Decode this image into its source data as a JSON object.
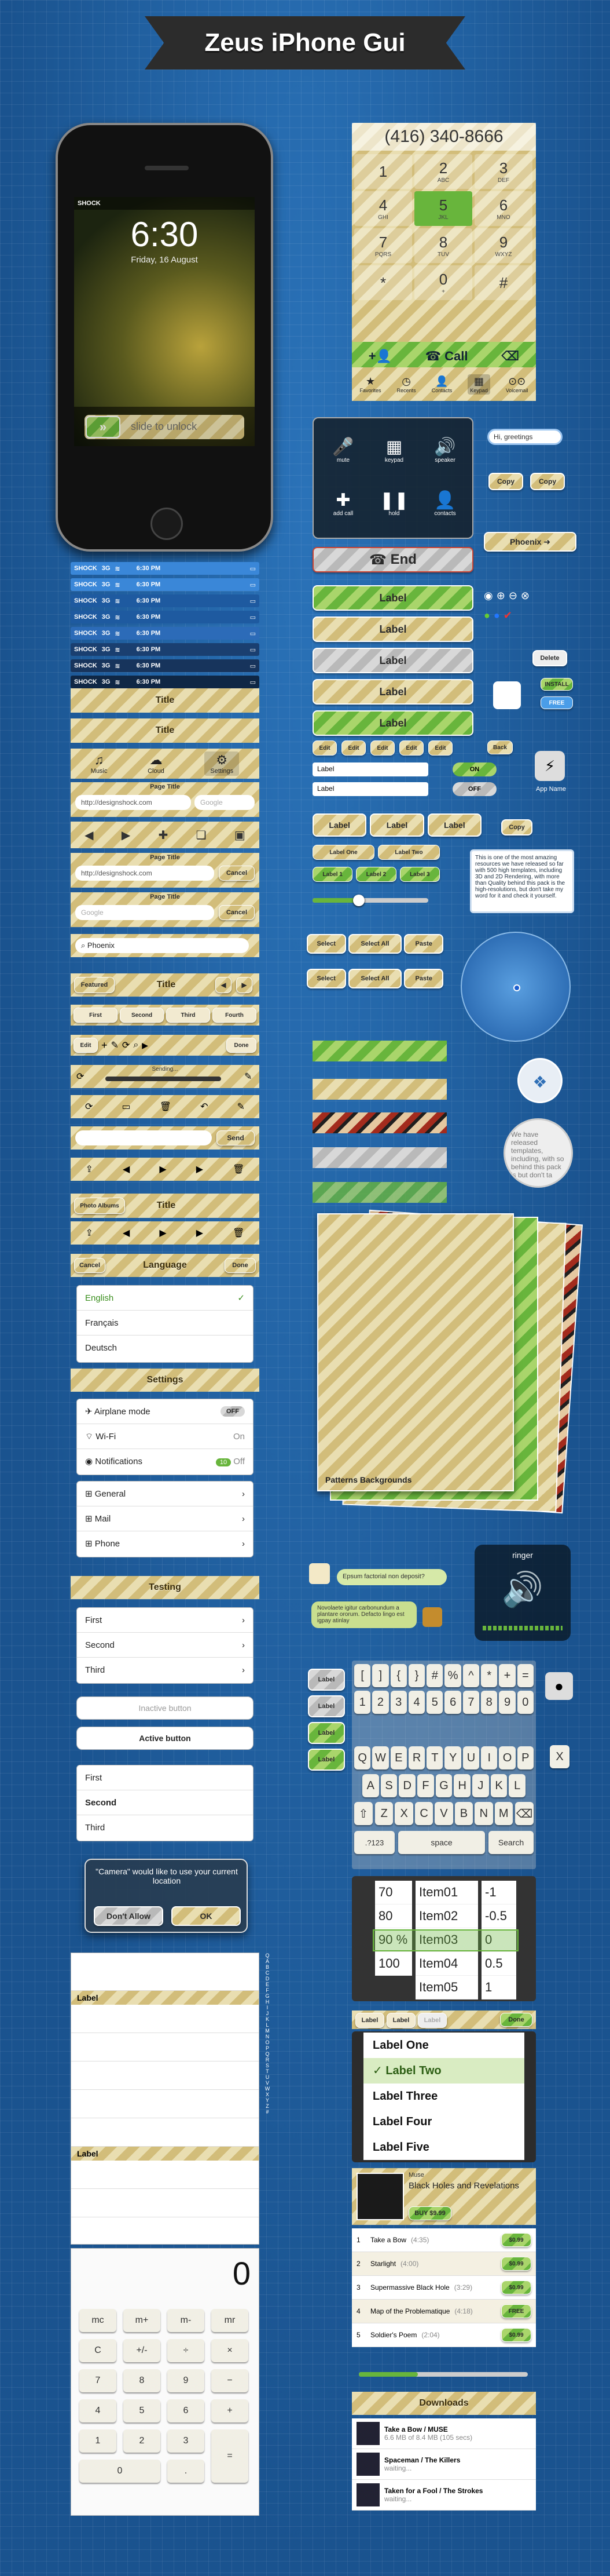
{
  "header": {
    "title": "Zeus iPhone Gui"
  },
  "lockscreen": {
    "carrier": "SHOCK",
    "time": "6:30",
    "date": "Friday, 16 August",
    "slider": "slide to unlock"
  },
  "statusbars": [
    {
      "carrier": "SHOCK",
      "net": "3G",
      "time": "6:30 PM"
    },
    {
      "carrier": "SHOCK",
      "net": "3G",
      "time": "6:30 PM"
    },
    {
      "carrier": "SHOCK",
      "net": "3G",
      "time": "6:30 PM"
    },
    {
      "carrier": "SHOCK",
      "net": "3G",
      "time": "6:30 PM"
    },
    {
      "carrier": "SHOCK",
      "net": "3G",
      "time": "6:30 PM"
    },
    {
      "carrier": "SHOCK",
      "net": "3G",
      "time": "6:30 PM"
    },
    {
      "carrier": "SHOCK",
      "net": "3G",
      "time": "6:30 PM"
    },
    {
      "carrier": "SHOCK",
      "net": "3G",
      "time": "6:30 PM"
    }
  ],
  "navbars": {
    "title": "Title",
    "tabs": [
      "Music",
      "Cloud",
      "Settings"
    ],
    "page_title": "Page Title",
    "url": "http://designshock.com",
    "search_placeholder": "Google",
    "cancel": "Cancel",
    "search_value": "Phoenix",
    "featured": "Featured",
    "segments": [
      "First",
      "Second",
      "Third",
      "Fourth"
    ],
    "edit": "Edit",
    "done": "Done",
    "sending": "Sending...",
    "send": "Send",
    "photo_albums": "Photo Albums"
  },
  "dialer": {
    "number": "(416) 340-8666",
    "keys": [
      {
        "d": "1",
        "l": ""
      },
      {
        "d": "2",
        "l": "ABC"
      },
      {
        "d": "3",
        "l": "DEF"
      },
      {
        "d": "4",
        "l": "GHI"
      },
      {
        "d": "5",
        "l": "JKL"
      },
      {
        "d": "6",
        "l": "MNO"
      },
      {
        "d": "7",
        "l": "PQRS"
      },
      {
        "d": "8",
        "l": "TUV"
      },
      {
        "d": "9",
        "l": "WXYZ"
      },
      {
        "d": "*",
        "l": ""
      },
      {
        "d": "0",
        "l": "+"
      },
      {
        "d": "#",
        "l": ""
      }
    ],
    "call": "Call",
    "tabs": [
      "Favorites",
      "Recents",
      "Contacts",
      "Keypad",
      "Voicemail"
    ]
  },
  "incall": {
    "buttons": [
      "mute",
      "keypad",
      "speaker",
      "add call",
      "hold",
      "contacts"
    ],
    "end": "End"
  },
  "labels": {
    "label": "Label",
    "edit": "Edit",
    "back": "Back",
    "on": "ON",
    "off": "OFF",
    "app_name": "App Name"
  },
  "bubbles": {
    "greeting": "Hi, greetings",
    "copy": "Copy",
    "phoenix": "Phoenix",
    "delete": "Delete",
    "install": "INSTALL",
    "free": "FREE",
    "label_one": "Label One",
    "label_two": "Label Two",
    "label_1": "Label 1",
    "label_2": "Label 2",
    "label_3": "Label 3"
  },
  "tooltip": {
    "text": "This is one of the most amazing resources we have released so far with 500 high templates, including 3D and 2D Rendering, with more than Quality behind this pack is the high-resolutions, but don't take my word for it and check it yourself."
  },
  "select_bar": {
    "select": "Select",
    "select_all": "Select All",
    "paste": "Paste"
  },
  "patterns": {
    "caption": "Patterns Backgrounds",
    "bubble": "We have released templates, including, with so behind this pack is but don't ta"
  },
  "messages": {
    "bubble1": "Epsum factorial non deposit?",
    "bubble2": "Novolaete igitur carbonundum a plantare ororum. Defacto lingo est igpay atinlay"
  },
  "ringer": {
    "title": "ringer"
  },
  "keyboard": {
    "row1": [
      "[",
      "]",
      "{",
      "}",
      "#",
      "%",
      "^",
      "*",
      "+",
      "="
    ],
    "row2": [
      "1",
      "2",
      "3",
      "4",
      "5",
      "6",
      "7",
      "8",
      "9",
      "0"
    ],
    "row3": [
      "Q",
      "W",
      "E",
      "R",
      "T",
      "Y",
      "U",
      "I",
      "O",
      "P"
    ],
    "row4": [
      "A",
      "S",
      "D",
      "F",
      "G",
      "H",
      "J",
      "K",
      "L"
    ],
    "row5": [
      "Z",
      "X",
      "C",
      "V",
      "B",
      "N",
      "M"
    ],
    "mode": ".?123",
    "space": "space",
    "search": "Search"
  },
  "picker": {
    "col1": [
      "70",
      "80",
      "90 %",
      "100"
    ],
    "col2": [
      "Item01",
      "Item02",
      "Item03",
      "Item04",
      "Item05"
    ],
    "col3": [
      "-1",
      "-0.5",
      "0",
      "0.5",
      "1"
    ],
    "list": [
      "Label One",
      "Label Two",
      "Label Three",
      "Label Four",
      "Label Five"
    ],
    "tabs": [
      "Label",
      "Label",
      "Label"
    ],
    "done": "Done"
  },
  "language": {
    "title": "Language",
    "cancel": "Cancel",
    "done": "Done",
    "items": [
      "English",
      "Français",
      "Deutsch"
    ]
  },
  "settings": {
    "title": "Settings",
    "group1": [
      {
        "label": "Airplane mode",
        "value": "OFF"
      },
      {
        "label": "Wi-Fi",
        "value": "On"
      },
      {
        "label": "Notifications",
        "value": "Off",
        "badge": "10"
      }
    ],
    "group2": [
      "General",
      "Mail",
      "Phone"
    ]
  },
  "testing": {
    "title": "Testing",
    "items": [
      "First",
      "Second",
      "Third"
    ],
    "inactive": "Inactive button",
    "active": "Active button",
    "items2": [
      "First",
      "Second",
      "Third"
    ]
  },
  "alert": {
    "message": "\"Camera\" would like to use your current location",
    "deny": "Don't Allow",
    "ok": "OK"
  },
  "index_list": {
    "label": "Label",
    "letters": [
      "Q",
      "A",
      "B",
      "C",
      "D",
      "E",
      "F",
      "G",
      "H",
      "I",
      "J",
      "K",
      "L",
      "M",
      "N",
      "O",
      "P",
      "Q",
      "R",
      "S",
      "T",
      "U",
      "V",
      "W",
      "X",
      "Y",
      "Z",
      "#"
    ]
  },
  "calculator": {
    "display": "0",
    "keys": [
      "mc",
      "m+",
      "m-",
      "mr",
      "C",
      "+/-",
      "÷",
      "×",
      "7",
      "8",
      "9",
      "−",
      "4",
      "5",
      "6",
      "+",
      "1",
      "2",
      "3",
      "=",
      "0",
      "."
    ]
  },
  "music": {
    "album": "Black Holes and Revelations",
    "artist": "Muse",
    "buy": "BUY $9.99",
    "tracks": [
      {
        "n": "1",
        "t": "Take a Bow",
        "d": "(4:35)",
        "p": "$0.99"
      },
      {
        "n": "2",
        "t": "Starlight",
        "d": "(4:00)",
        "p": "$0.99"
      },
      {
        "n": "3",
        "t": "Supermassive Black Hole",
        "d": "(3:29)",
        "p": "$0.99"
      },
      {
        "n": "4",
        "t": "Map of the Problematique",
        "d": "(4:18)",
        "p": "FREE"
      },
      {
        "n": "5",
        "t": "Soldier's Poem",
        "d": "(2:04)",
        "p": "$0.99"
      }
    ]
  },
  "downloads": {
    "title": "Downloads",
    "items": [
      {
        "t": "Take a Bow / MUSE",
        "s": "6.6 MB of 8.4 MB (105 secs)"
      },
      {
        "t": "Spaceman / The Killers",
        "s": "waiting..."
      },
      {
        "t": "Taken for a Fool / The Strokes",
        "s": "waiting..."
      }
    ]
  },
  "colors": {
    "tan": "#d2bd7a",
    "green": "#68b53c",
    "blue_bg": "#1f5d9c",
    "dark": "#2c2c2c"
  }
}
